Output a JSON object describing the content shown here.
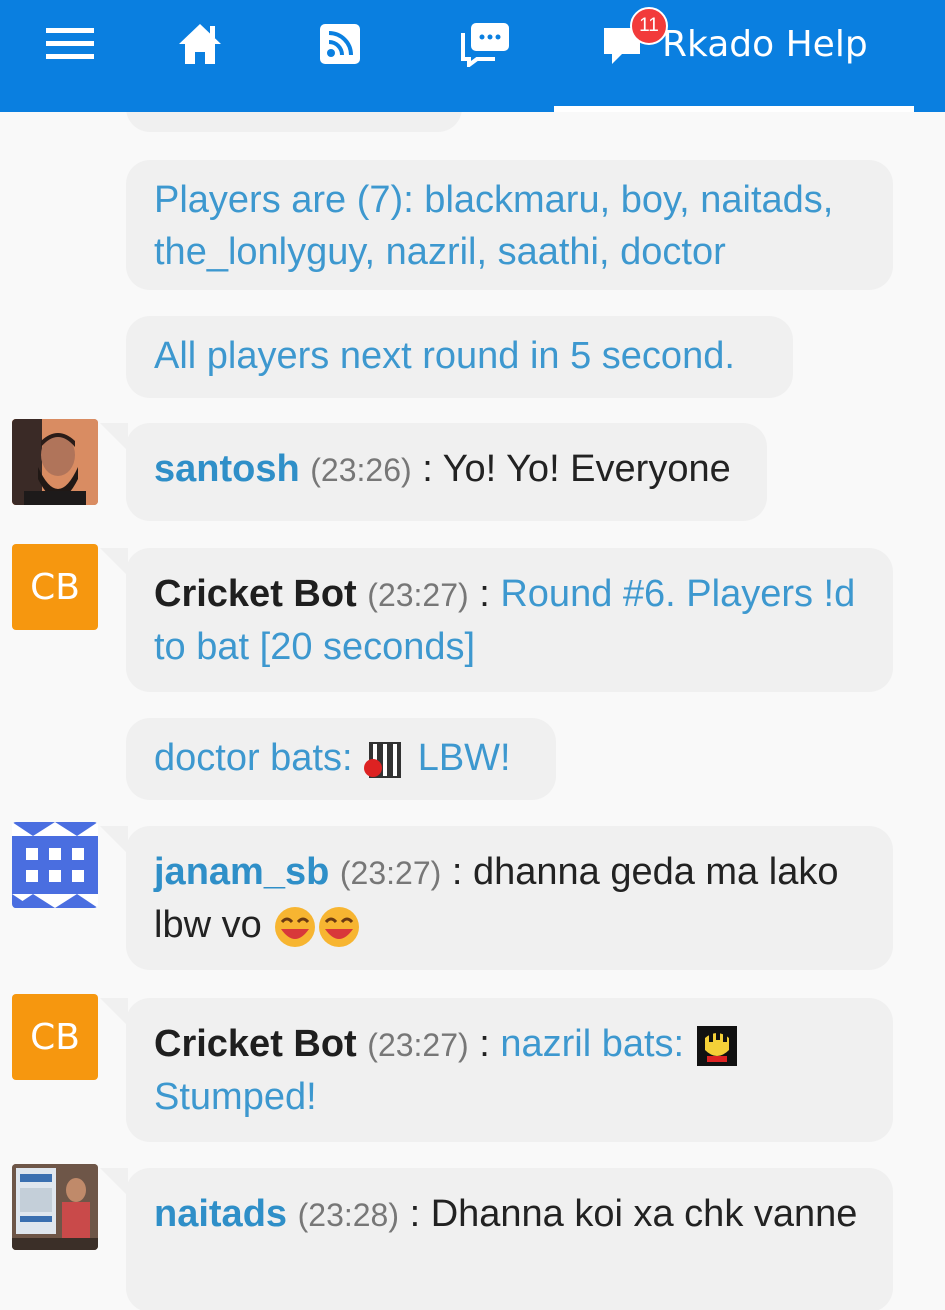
{
  "header": {
    "tabs": [
      {
        "name": "menu-icon"
      },
      {
        "name": "home-icon"
      },
      {
        "name": "feed-icon"
      },
      {
        "name": "chat-rooms-icon"
      }
    ],
    "help_label": "Rkado Help",
    "notif_count": "11",
    "accent": "#0a7fe0",
    "badge_color": "#f23b3b"
  },
  "messages": {
    "sys1": "Players are (7): blackmaru, boy, naitads, the_lonlyguy, nazril, saathi, doctor",
    "sys2": "All players next round in 5 second.",
    "m1": {
      "user": "santosh",
      "time": "(23:26)",
      "sep": ":",
      "text": "Yo! Yo! Everyone"
    },
    "m2": {
      "avatar": "CB",
      "user": "Cricket Bot",
      "time": "(23:27)",
      "sep": ":",
      "text": "Round #6. Players !d to bat [20 seconds]"
    },
    "sys3": {
      "prefix": "doctor bats:",
      "result": "LBW!"
    },
    "m3": {
      "user": "janam_sb",
      "time": "(23:27)",
      "sep": ":",
      "text": "dhanna geda ma lako lbw vo"
    },
    "m4": {
      "avatar": "CB",
      "user": "Cricket Bot",
      "time": "(23:27)",
      "sep": ":",
      "text_prefix": "nazril bats:",
      "text_result": "Stumped!"
    },
    "m5": {
      "user": "naitads",
      "time": "(23:28)",
      "sep": ":",
      "text": "Dhanna koi xa chk vanne"
    }
  },
  "colors": {
    "bubble_bg": "#f0f0f0",
    "system_text": "#3d98cf",
    "bot_avatar": "#f6970f"
  }
}
